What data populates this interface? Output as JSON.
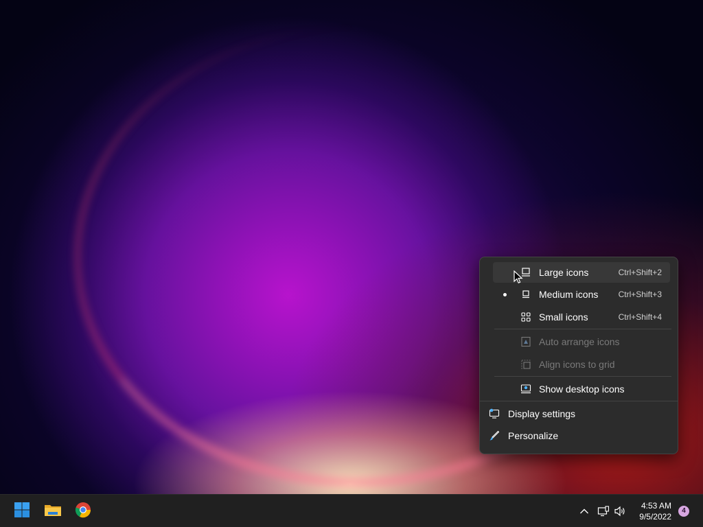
{
  "context_menu": {
    "view_items": [
      {
        "label": "Large icons",
        "shortcut": "Ctrl+Shift+2",
        "icon": "large-icons-icon",
        "selected": false,
        "disabled": false
      },
      {
        "label": "Medium icons",
        "shortcut": "Ctrl+Shift+3",
        "icon": "medium-icons-icon",
        "selected": true,
        "disabled": false
      },
      {
        "label": "Small icons",
        "shortcut": "Ctrl+Shift+4",
        "icon": "small-icons-icon",
        "selected": false,
        "disabled": false
      }
    ],
    "arrange_items": [
      {
        "label": "Auto arrange icons",
        "icon": "auto-arrange-icon",
        "disabled": true
      },
      {
        "label": "Align icons to grid",
        "icon": "align-grid-icon",
        "disabled": true
      }
    ],
    "show_desktop_icons": {
      "label": "Show desktop icons",
      "icon": "show-desktop-icons-icon"
    },
    "bottom_items": [
      {
        "label": "Display settings",
        "icon": "display-settings-icon"
      },
      {
        "label": "Personalize",
        "icon": "personalize-brush-icon"
      }
    ]
  },
  "taskbar": {
    "pinned": [
      {
        "name": "Start",
        "icon": "windows-start-icon"
      },
      {
        "name": "File Explorer",
        "icon": "file-explorer-icon"
      },
      {
        "name": "Google Chrome",
        "icon": "chrome-icon"
      }
    ],
    "tray": {
      "chevron_icon": "chevron-up-icon",
      "network_icon": "network-icon",
      "volume_icon": "volume-icon"
    },
    "time": "4:53 AM",
    "date": "9/5/2022",
    "notification_count": "4"
  },
  "colors": {
    "menu_bg": "#2c2c2c",
    "taskbar_bg": "#202020",
    "windows_blue": "#1da1f2",
    "folder_yellow": "#f5c242"
  }
}
